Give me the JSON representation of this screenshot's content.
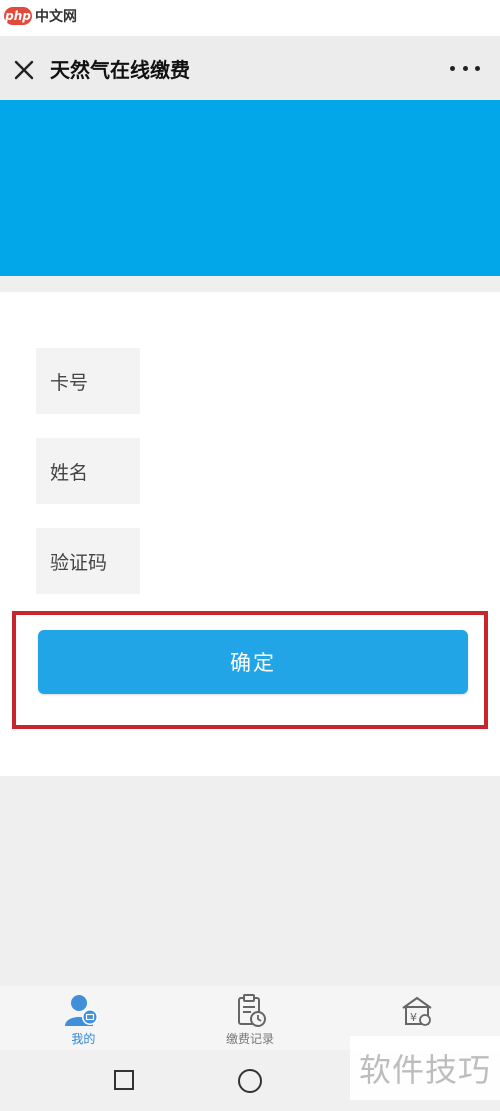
{
  "watermark": {
    "logo_text": "php",
    "site_name": "中文网",
    "bottom_text": "软件技巧"
  },
  "header": {
    "title": "天然气在线缴费",
    "close_icon": "close-icon",
    "more_icon": "more-dots-icon"
  },
  "banner": {
    "color": "#02a7ea"
  },
  "form": {
    "card_number_label": "卡号",
    "card_number_value": "",
    "name_label": "姓名",
    "name_value": "",
    "captcha_label": "验证码",
    "captcha_value": "",
    "confirm_label": "确定",
    "confirm_color": "#21a5e6",
    "highlight_color": "#c9252c"
  },
  "tabbar": {
    "tabs": [
      {
        "label": "我的",
        "icon": "user-card-icon",
        "active": true
      },
      {
        "label": "缴费记录",
        "icon": "clipboard-clock-icon",
        "active": false
      },
      {
        "label": "",
        "icon": "yen-building-icon",
        "active": false
      }
    ],
    "active_color": "#2f86d6"
  },
  "system_nav": {
    "recent_icon": "square-icon",
    "home_icon": "circle-icon"
  }
}
